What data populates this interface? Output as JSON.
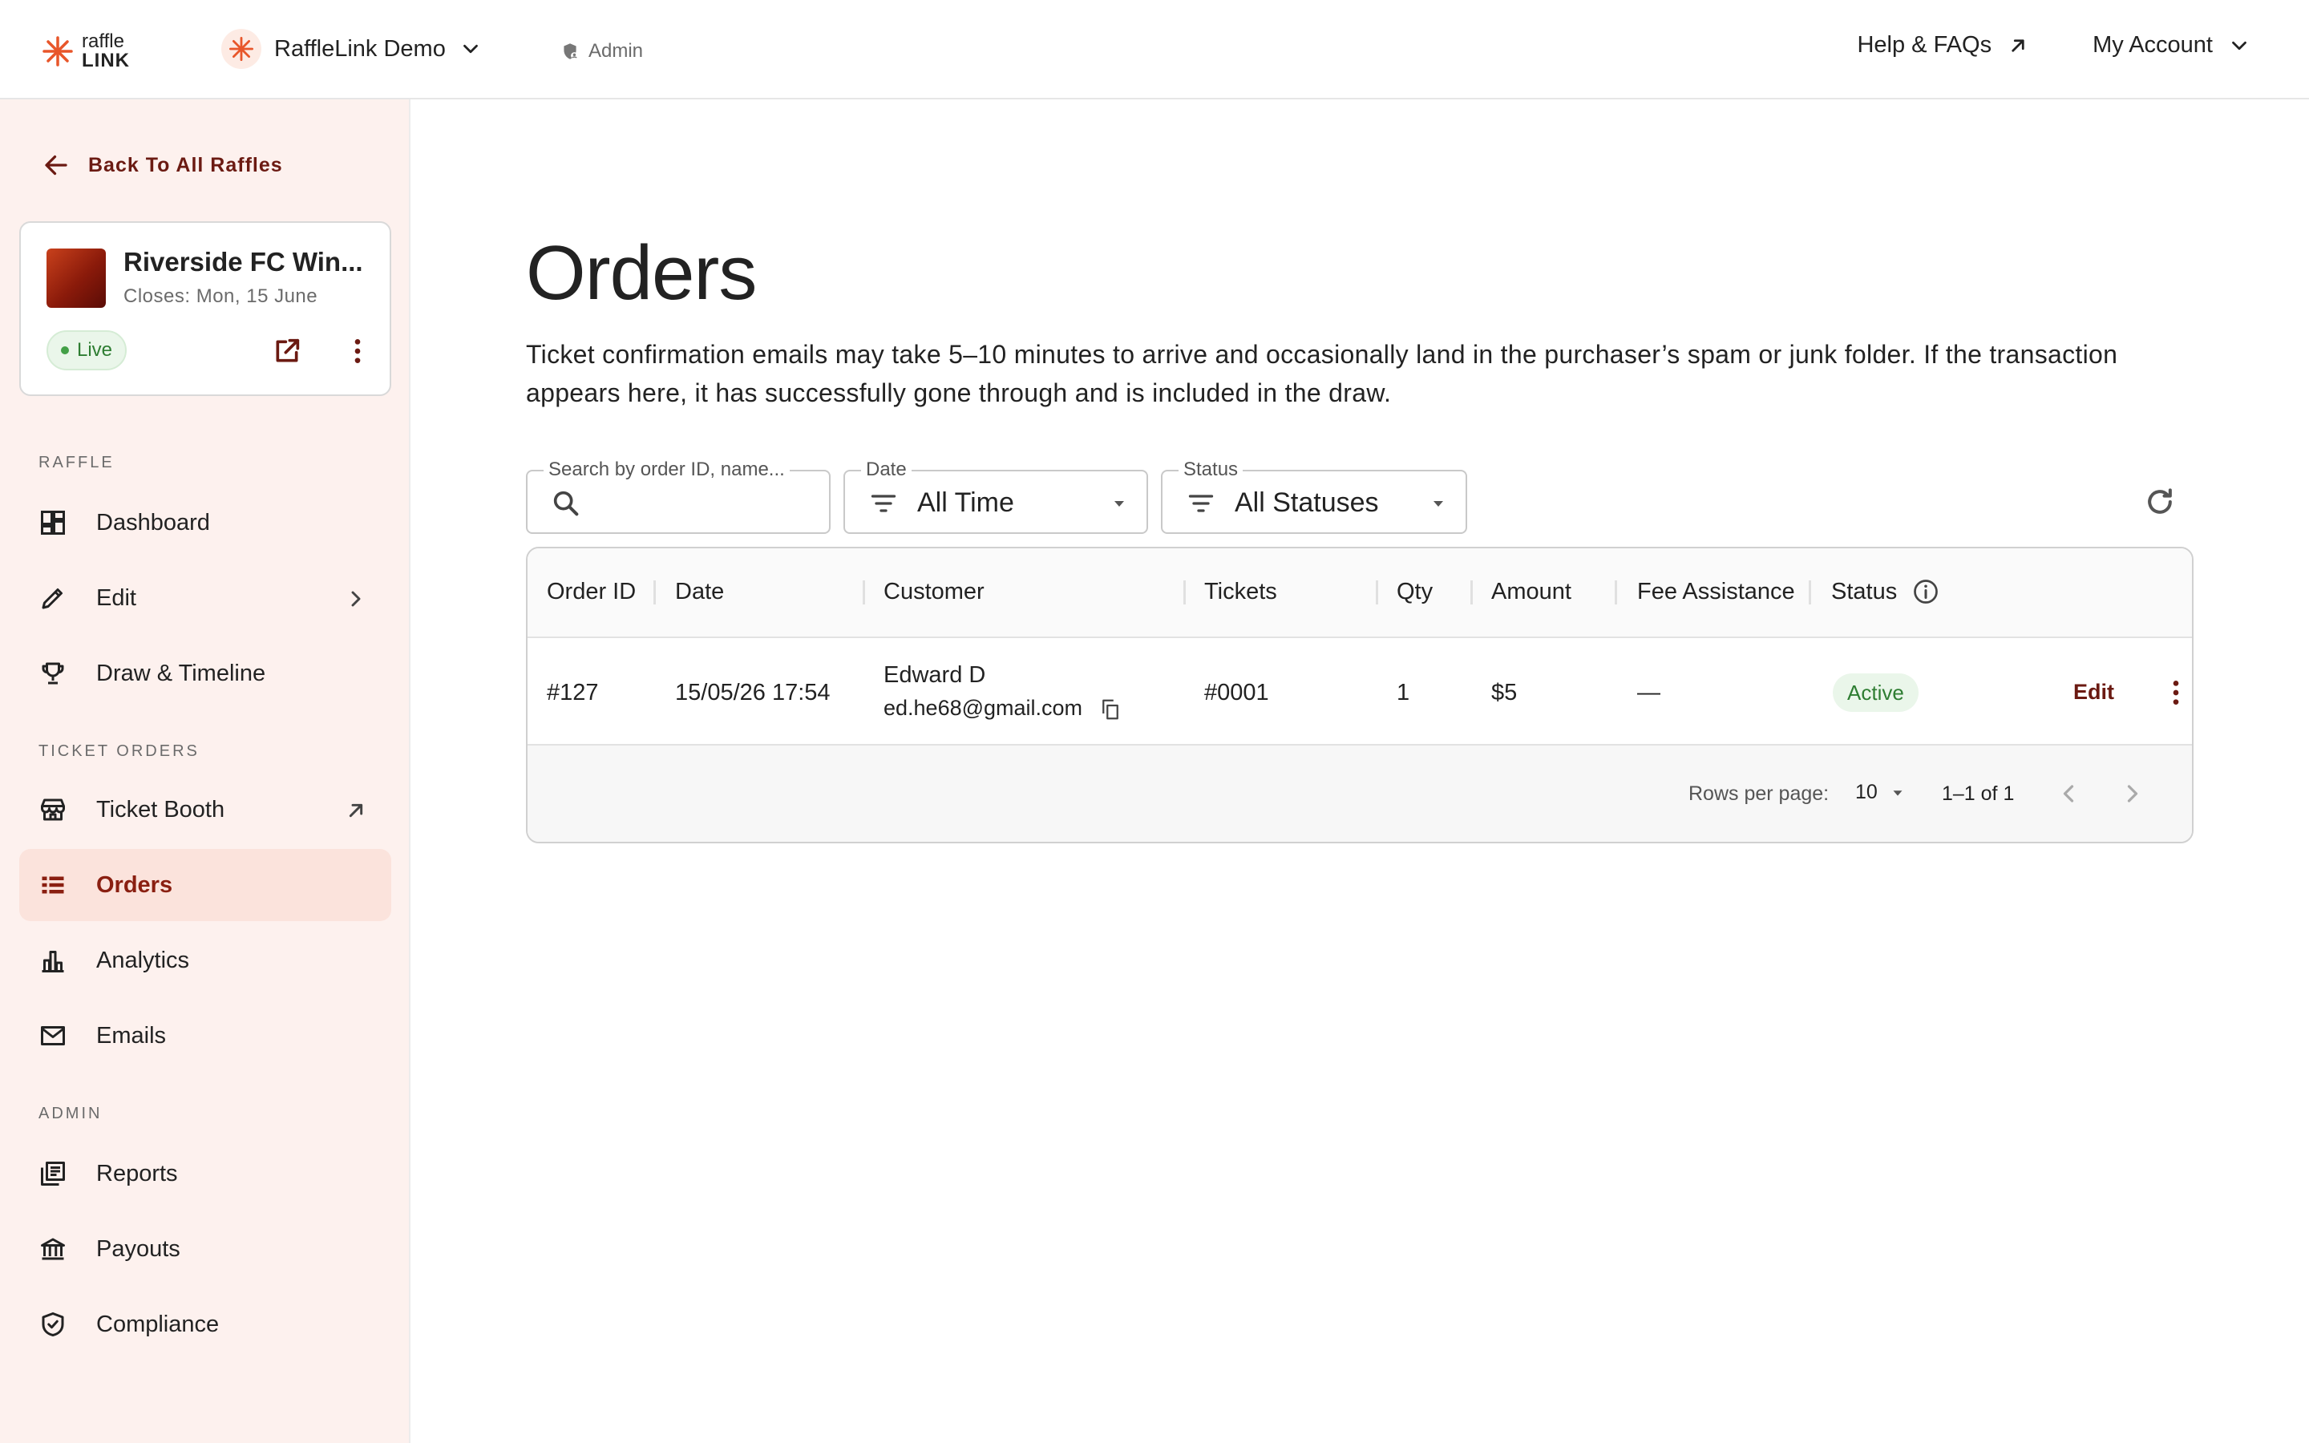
{
  "app": {
    "logo_line1": "raffle",
    "logo_line2": "LINK"
  },
  "header": {
    "org_name": "RaffleLink Demo",
    "role": "Admin",
    "help_label": "Help & FAQs",
    "account_label": "My Account"
  },
  "sidebar": {
    "back_label": "Back To All Raffles",
    "raffle": {
      "title": "Riverside FC Win...",
      "closes": "Closes: Mon, 15 June",
      "status": "Live"
    },
    "sections": {
      "raffle": "RAFFLE",
      "ticket_orders": "TICKET ORDERS",
      "admin": "ADMIN"
    },
    "items": {
      "dashboard": "Dashboard",
      "edit": "Edit",
      "draw": "Draw & Timeline",
      "ticket_booth": "Ticket Booth",
      "orders": "Orders",
      "analytics": "Analytics",
      "emails": "Emails",
      "reports": "Reports",
      "payouts": "Payouts",
      "compliance": "Compliance"
    }
  },
  "main": {
    "title": "Orders",
    "description": "Ticket confirmation emails may take 5–10 minutes to arrive and occasionally land in the purchaser’s spam or junk folder. If the transaction appears here, it has successfully gone through and is included in the draw.",
    "filters": {
      "search_label": "Search by order ID, name...",
      "search_value": "",
      "date_label": "Date",
      "date_value": "All Time",
      "status_label": "Status",
      "status_value": "All Statuses"
    },
    "table": {
      "columns": [
        "Order ID",
        "Date",
        "Customer",
        "Tickets",
        "Qty",
        "Amount",
        "Fee Assistance",
        "Status"
      ],
      "rows": [
        {
          "order_id": "#127",
          "date": "15/05/26 17:54",
          "customer_name": "Edward D",
          "customer_email": "ed.he68@gmail.com",
          "tickets": "#0001",
          "qty": "1",
          "amount": "$5",
          "fee_assistance": "—",
          "status": "Active",
          "action": "Edit"
        }
      ],
      "footer": {
        "rows_per_page_label": "Rows per page:",
        "rows_per_page": "10",
        "range": "1–1 of 1"
      }
    }
  },
  "colors": {
    "brand": "#e8562a",
    "accent_dark": "#6b1a12",
    "sidebar_bg": "#fdf1ee",
    "active_bg": "#fbe3dc",
    "live_green": "#2e7d32"
  }
}
